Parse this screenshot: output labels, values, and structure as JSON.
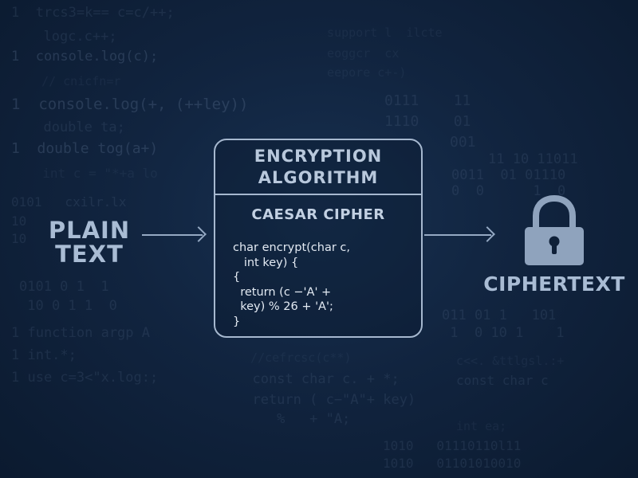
{
  "diagram": {
    "plain_label": [
      "PLAIN",
      "TEXT"
    ],
    "algorithm_box": {
      "title_lines": [
        "ENCRYPTION",
        "ALGORITHM"
      ],
      "subtitle": "CAESAR CIPHER",
      "code_lines": [
        "char encrypt(char c,",
        "   int key) {",
        "{",
        "  return (c −'A' +",
        "  key) % 26 + 'A';",
        "}"
      ]
    },
    "cipher_label": "CIPHERTEXT",
    "lock_icon": "padlock-icon"
  },
  "background_code": [
    "1  trcs3=k== c=c/++;",
    "  logc.c++;",
    "1  console.log(c);",
    "  // cnicfn=r",
    "1  console.log(+, (++ley))",
    "  double ta;",
    "1  double tog(a+)",
    "  int c = \"*+a lo",
    "0101   cxilr.lx",
    "10",
    "10",
    "0101 0 1  1",
    " 10 0 1 1  0",
    "1 function argp A",
    "1 int.*;",
    "1 use c=3<\"x.log:;",
    "  //cefrcsc(c**)",
    "  const char c. + *;",
    "  return ( c−\"A\"+ key)",
    "     %   + \"A;",
    "  support l  ilcte",
    "  eoggcr  cx",
    "  eepore c+-)",
    "0111    11",
    "1110    01",
    "001",
    "11 10 11011",
    "0011  01 01110",
    "0  0      1  0",
    "011 01 1   101",
    " 1  0 10 1    1",
    "c<<. &ttlgsl.:+",
    "const char c",
    "int ea;",
    "1010   01110110l11",
    "1010   01101010010"
  ]
}
